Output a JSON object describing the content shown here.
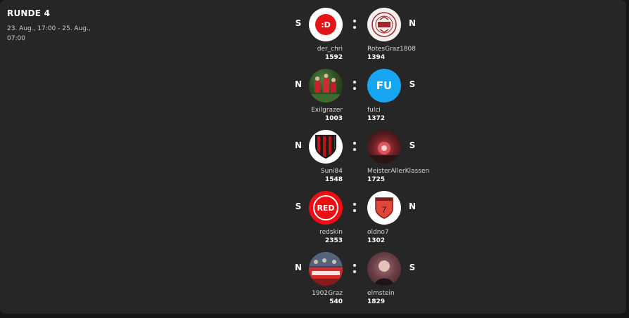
{
  "round": {
    "title": "RUNDE 4",
    "dates": "23. Aug., 17:00 - 25. Aug., 07:00"
  },
  "colors": {
    "background": "#161616",
    "card": "#262626",
    "accent_blue": "#16a5f0",
    "accent_red": "#ee0d12"
  },
  "matches": [
    {
      "left": {
        "side": "S",
        "name": "der_chri",
        "score": "1592",
        "avatar_text": ":D",
        "avatar_icon": "red-smiley-icon"
      },
      "right": {
        "side": "N",
        "name": "RotesGraz1808",
        "score": "1394",
        "avatar_icon": "club-crest-icon"
      }
    },
    {
      "left": {
        "side": "N",
        "name": "Exilgrazer",
        "score": "1003",
        "avatar_icon": "football-photo-icon"
      },
      "right": {
        "side": "S",
        "name": "fulci",
        "score": "1372",
        "avatar_text": "FU",
        "avatar_icon": "initials-icon"
      }
    },
    {
      "left": {
        "side": "N",
        "name": "Suni84",
        "score": "1548",
        "avatar_icon": "striped-shield-icon"
      },
      "right": {
        "side": "S",
        "name": "MeisterAllerKlassen",
        "score": "1725",
        "avatar_icon": "pyro-photo-icon"
      }
    },
    {
      "left": {
        "side": "S",
        "name": "redskin",
        "score": "2353",
        "avatar_text": "RED",
        "avatar_icon": "red-badge-icon"
      },
      "right": {
        "side": "N",
        "name": "oldno7",
        "score": "1302",
        "avatar_text": "7",
        "avatar_icon": "number-shield-icon"
      }
    },
    {
      "left": {
        "side": "N",
        "name": "1902Graz",
        "score": "540",
        "avatar_icon": "banner-photo-icon"
      },
      "right": {
        "side": "S",
        "name": "elmstein",
        "score": "1829",
        "avatar_icon": "portrait-photo-icon"
      }
    }
  ]
}
